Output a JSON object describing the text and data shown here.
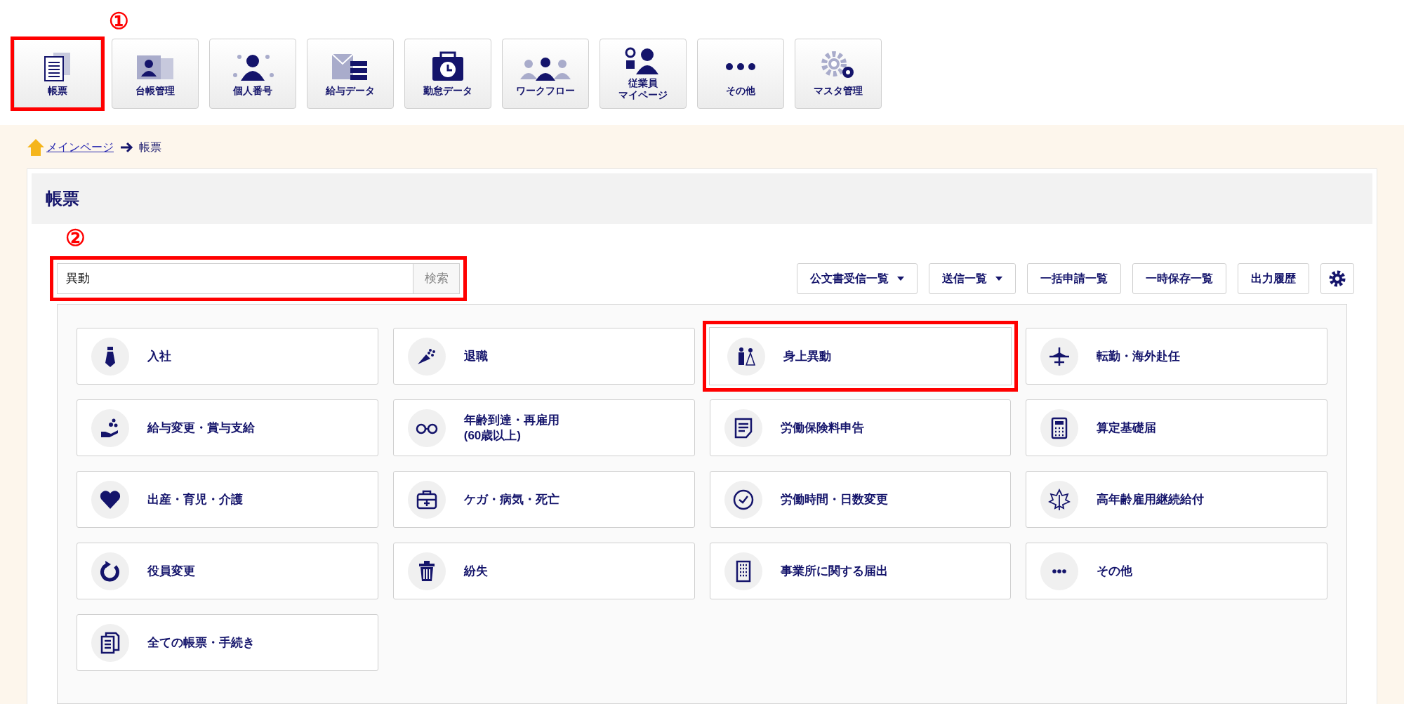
{
  "nav": [
    {
      "label": "帳票",
      "highlighted": true,
      "marker": "①"
    },
    {
      "label": "台帳管理",
      "highlighted": false
    },
    {
      "label": "個人番号",
      "highlighted": false
    },
    {
      "label": "給与データ",
      "highlighted": false
    },
    {
      "label": "勤怠データ",
      "highlighted": false
    },
    {
      "label": "ワークフロー",
      "highlighted": false
    },
    {
      "label": "従業員",
      "label_line2": "マイページ",
      "highlighted": false
    },
    {
      "label": "その他",
      "highlighted": false
    },
    {
      "label": "マスタ管理",
      "highlighted": false
    }
  ],
  "breadcrumb": {
    "link": "メインページ",
    "current": "帳票"
  },
  "page_title": "帳票",
  "search": {
    "marker": "②",
    "value": "異動",
    "button": "検索",
    "highlighted": true
  },
  "actions": [
    {
      "label": "公文書受信一覧",
      "kind": "dropdown"
    },
    {
      "label": "送信一覧",
      "kind": "dropdown"
    },
    {
      "label": "一括申請一覧",
      "kind": "plain"
    },
    {
      "label": "一時保存一覧",
      "kind": "plain"
    },
    {
      "label": "出力履歴",
      "kind": "plain"
    },
    {
      "kind": "settings"
    }
  ],
  "cards": [
    {
      "label": "入社",
      "highlighted": false
    },
    {
      "label": "退職",
      "highlighted": false
    },
    {
      "label": "身上異動",
      "highlighted": true
    },
    {
      "label": "転勤・海外赴任",
      "highlighted": false
    },
    {
      "label": "給与変更・賞与支給",
      "highlighted": false
    },
    {
      "label": "年齢到達・再雇用\n(60歳以上)",
      "highlighted": false
    },
    {
      "label": "労働保険料申告",
      "highlighted": false
    },
    {
      "label": "算定基礎届",
      "highlighted": false
    },
    {
      "label": "出産・育児・介護",
      "highlighted": false
    },
    {
      "label": "ケガ・病気・死亡",
      "highlighted": false
    },
    {
      "label": "労働時間・日数変更",
      "highlighted": false
    },
    {
      "label": "高年齢雇用継続給付",
      "highlighted": false
    },
    {
      "label": "役員変更",
      "highlighted": false
    },
    {
      "label": "紛失",
      "highlighted": false
    },
    {
      "label": "事業所に関する届出",
      "highlighted": false
    },
    {
      "label": "その他",
      "highlighted": false
    },
    {
      "label": "全ての帳票・手続き",
      "highlighted": false
    }
  ]
}
